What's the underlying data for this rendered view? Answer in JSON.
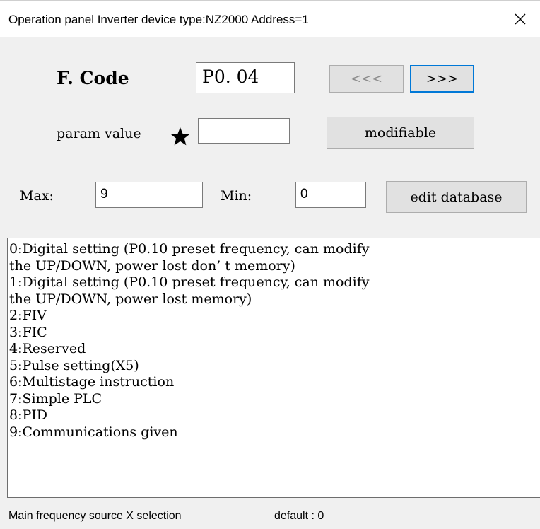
{
  "window": {
    "title": "Operation panel Inverter device type:NZ2000  Address=1",
    "close_icon": "close-icon"
  },
  "form": {
    "fcode_label": "F. Code",
    "fcode_value": "P0. 04",
    "prev_label": "<<<",
    "next_label": ">>>",
    "param_label": "param value",
    "param_icon": "star-icon",
    "param_value": "",
    "modifiable_label": "modifiable",
    "max_label": "Max:",
    "max_value": "9",
    "min_label": "Min:",
    "min_value": "0",
    "edit_db_label": "edit database"
  },
  "description": {
    "lines": [
      "0:Digital setting (P0.10 preset frequency, can modify",
      "the UP/DOWN, power lost don’ t memory)",
      "1:Digital setting (P0.10 preset frequency, can modify",
      "the UP/DOWN, power lost memory)",
      "2:FIV",
      "3:FIC",
      "4:Reserved",
      "5:Pulse setting(X5)",
      "6:Multistage instruction",
      "7:Simple PLC",
      "8:PID",
      "9:Communications given"
    ]
  },
  "status": {
    "left": "Main frequency source X selection",
    "right": "default : 0"
  }
}
